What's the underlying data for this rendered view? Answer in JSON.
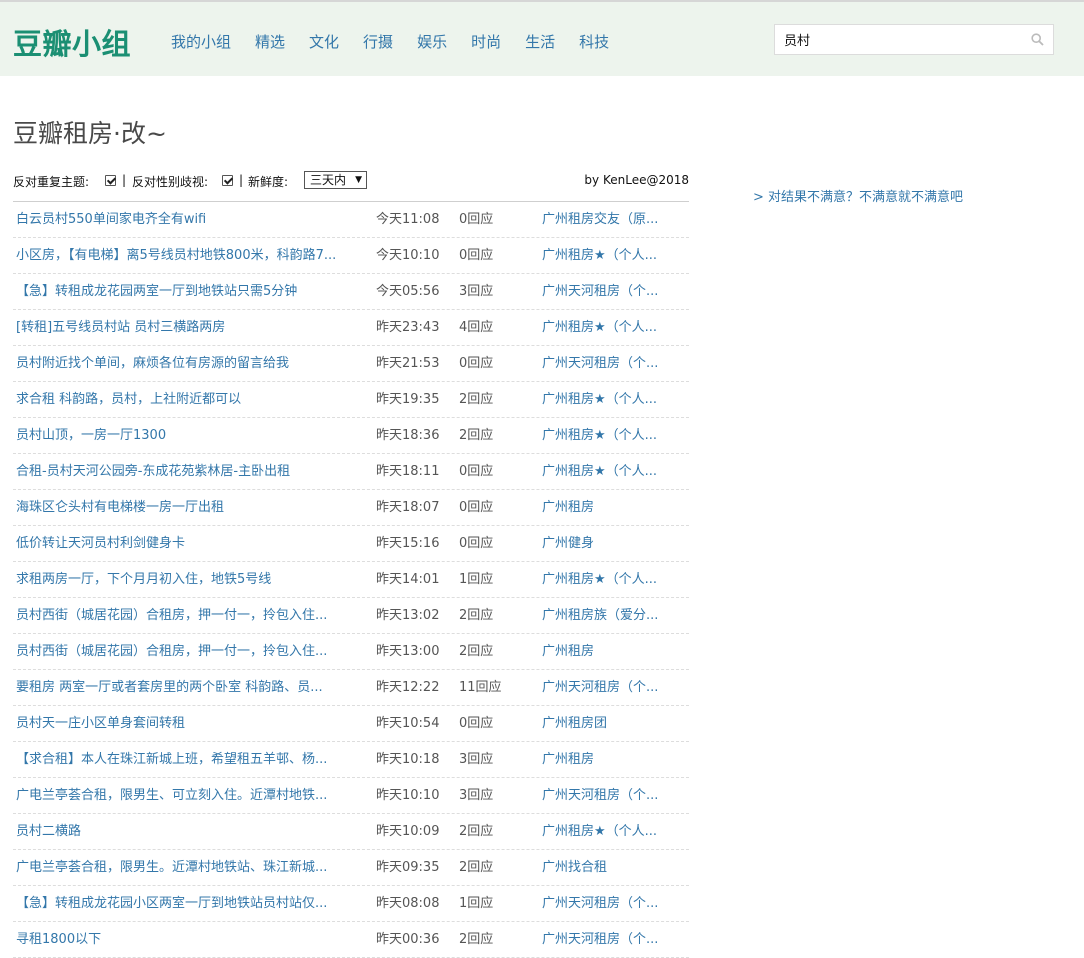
{
  "header": {
    "logo": "豆瓣小组",
    "nav": [
      "我的小组",
      "精选",
      "文化",
      "行摄",
      "娱乐",
      "时尚",
      "生活",
      "科技"
    ],
    "search_value": "员村"
  },
  "page": {
    "title": "豆瓣租房·改~",
    "filters": {
      "dedupe_label": "反对重复主题:",
      "dedupe_checked": true,
      "sep1": "|",
      "gender_label": "反对性别歧视:",
      "gender_checked": true,
      "sep2": "|",
      "freshness_label": "新鲜度:",
      "freshness_value": "三天内",
      "by": "by KenLee@2018"
    },
    "feedback_link": "> 对结果不满意？不满意就不满意吧"
  },
  "rows": [
    {
      "title": "白云员村550单间家电齐全有wifi",
      "time": "今天11:08",
      "replies": "0回应",
      "group": "广州租房交友（原..."
    },
    {
      "title": "小区房，【有电梯】离5号线员村地铁800米，科韵路7...",
      "time": "今天10:10",
      "replies": "0回应",
      "group": "广州租房★（个人..."
    },
    {
      "title": "【急】转租成龙花园两室一厅到地铁站只需5分钟",
      "time": "今天05:56",
      "replies": "3回应",
      "group": "广州天河租房（个..."
    },
    {
      "title": "[转租]五号线员村站 员村三横路两房",
      "time": "昨天23:43",
      "replies": "4回应",
      "group": "广州租房★（个人..."
    },
    {
      "title": "员村附近找个单间，麻烦各位有房源的留言给我",
      "time": "昨天21:53",
      "replies": "0回应",
      "group": "广州天河租房（个..."
    },
    {
      "title": "求合租 科韵路，员村，上社附近都可以",
      "time": "昨天19:35",
      "replies": "2回应",
      "group": "广州租房★（个人..."
    },
    {
      "title": "员村山顶，一房一厅1300",
      "time": "昨天18:36",
      "replies": "2回应",
      "group": "广州租房★（个人..."
    },
    {
      "title": "合租-员村天河公园旁-东成花苑紫林居-主卧出租",
      "time": "昨天18:11",
      "replies": "0回应",
      "group": "广州租房★（个人..."
    },
    {
      "title": "海珠区仑头村有电梯楼一房一厅出租",
      "time": "昨天18:07",
      "replies": "0回应",
      "group": "广州租房"
    },
    {
      "title": "低价转让天河员村利剑健身卡",
      "time": "昨天15:16",
      "replies": "0回应",
      "group": "广州健身"
    },
    {
      "title": "求租两房一厅，下个月月初入住，地铁5号线",
      "time": "昨天14:01",
      "replies": "1回应",
      "group": "广州租房★（个人..."
    },
    {
      "title": "员村西街（城居花园）合租房，押一付一，拎包入住...",
      "time": "昨天13:02",
      "replies": "2回应",
      "group": "广州租房族（爱分..."
    },
    {
      "title": "员村西街（城居花园）合租房，押一付一，拎包入住...",
      "time": "昨天13:00",
      "replies": "2回应",
      "group": "广州租房"
    },
    {
      "title": "要租房 两室一厅或者套房里的两个卧室 科韵路、员...",
      "time": "昨天12:22",
      "replies": "11回应",
      "group": "广州天河租房（个..."
    },
    {
      "title": "员村天一庄小区单身套间转租",
      "time": "昨天10:54",
      "replies": "0回应",
      "group": "广州租房团"
    },
    {
      "title": "【求合租】本人在珠江新城上班，希望租五羊邨、杨...",
      "time": "昨天10:18",
      "replies": "3回应",
      "group": "广州租房"
    },
    {
      "title": "广电兰亭荟合租，限男生、可立刻入住。近潭村地铁...",
      "time": "昨天10:10",
      "replies": "3回应",
      "group": "广州天河租房（个..."
    },
    {
      "title": "员村二横路",
      "time": "昨天10:09",
      "replies": "2回应",
      "group": "广州租房★（个人..."
    },
    {
      "title": "广电兰亭荟合租，限男生。近潭村地铁站、珠江新城...",
      "time": "昨天09:35",
      "replies": "2回应",
      "group": "广州找合租"
    },
    {
      "title": "【急】转租成龙花园小区两室一厅到地铁站员村站仅...",
      "time": "昨天08:08",
      "replies": "1回应",
      "group": "广州天河租房（个..."
    },
    {
      "title": "寻租1800以下",
      "time": "昨天00:36",
      "replies": "2回应",
      "group": "广州天河租房（个..."
    }
  ]
}
